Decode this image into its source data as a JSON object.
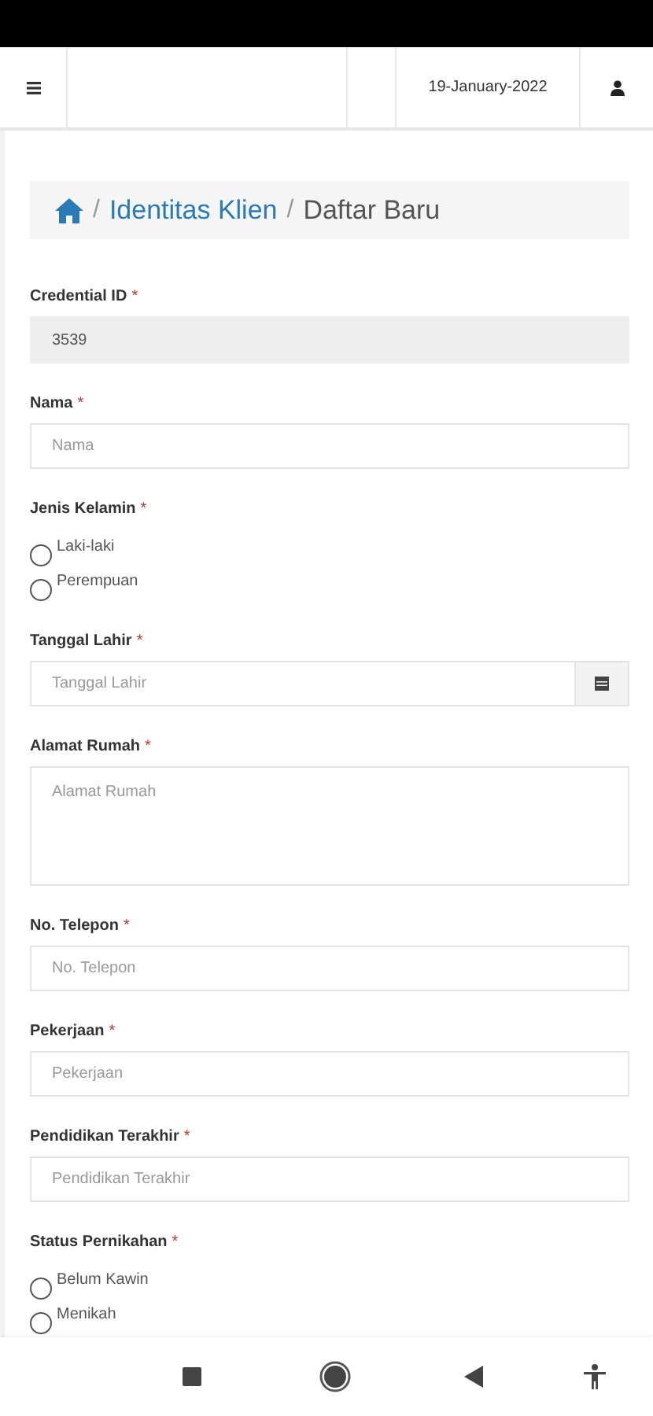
{
  "header": {
    "date": "19-January-2022"
  },
  "breadcrumb": {
    "items": [
      {
        "separator": "/",
        "label": "Identitas Klien",
        "kind": "link"
      },
      {
        "separator": "/",
        "label": "Daftar Baru",
        "kind": "current"
      }
    ]
  },
  "fields": [
    {
      "kind": "readonly",
      "label": "Credential ID",
      "required_mark": "*",
      "value": "3539"
    },
    {
      "kind": "text",
      "label": "Nama",
      "required_mark": "*",
      "placeholder": "Nama"
    },
    {
      "kind": "radio",
      "label": "Jenis Kelamin",
      "required_mark": "*",
      "options": [
        {
          "label": "Laki-laki",
          "selected": false
        },
        {
          "label": "Perempuan",
          "selected": false
        }
      ]
    },
    {
      "kind": "date",
      "label": "Tanggal Lahir",
      "required_mark": "*",
      "placeholder": "Tanggal Lahir"
    },
    {
      "kind": "textarea",
      "label": "Alamat Rumah",
      "required_mark": "*",
      "placeholder": "Alamat Rumah"
    },
    {
      "kind": "text",
      "label": "No. Telepon",
      "required_mark": "*",
      "placeholder": "No. Telepon"
    },
    {
      "kind": "text",
      "label": "Pekerjaan",
      "required_mark": "*",
      "placeholder": "Pekerjaan"
    },
    {
      "kind": "text",
      "label": "Pendidikan Terakhir",
      "required_mark": "*",
      "placeholder": "Pendidikan Terakhir"
    },
    {
      "kind": "radio",
      "label": "Status Pernikahan",
      "required_mark": "*",
      "options": [
        {
          "label": "Belum Kawin",
          "selected": false
        },
        {
          "label": "Menikah",
          "selected": false
        }
      ]
    }
  ]
}
